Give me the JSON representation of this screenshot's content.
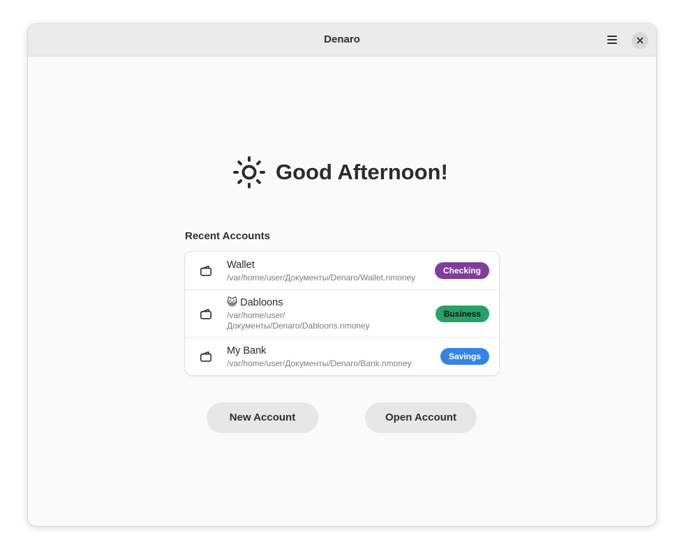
{
  "window": {
    "title": "Denaro"
  },
  "icons": {
    "menu": "hamburger-menu-icon",
    "close": "close-icon",
    "greeting": "sun-icon",
    "account": "wallet-icon"
  },
  "greeting": {
    "text": "Good Afternoon!"
  },
  "recent": {
    "title": "Recent Accounts",
    "accounts": [
      {
        "name": "Wallet",
        "path": "/var/home/user/Документы/Denaro/Wallet.nmoney",
        "type": "Checking",
        "color": "#813d9c"
      },
      {
        "name": "😺 Dabloons",
        "path": "/var/home/user/Документы/Denaro/Dabloons.nmoney",
        "type": "Business",
        "color": "#26a269"
      },
      {
        "name": "My Bank",
        "path": "/var/home/user/Документы/Denaro/Bank.nmoney",
        "type": "Savings",
        "color": "#3584e4"
      }
    ]
  },
  "actions": {
    "new_account": "New Account",
    "open_account": "Open Account"
  }
}
